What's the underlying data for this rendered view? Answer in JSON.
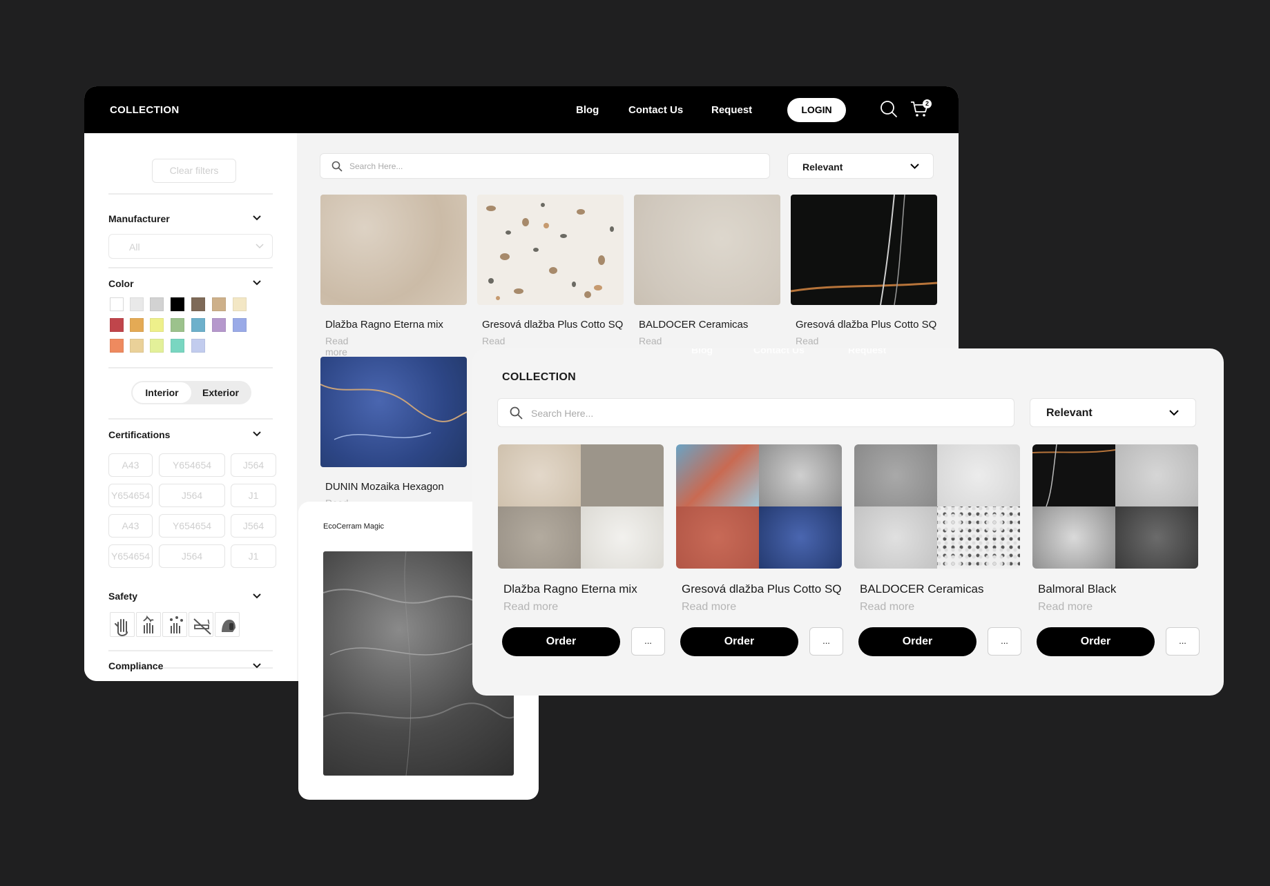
{
  "main": {
    "brand": "COLLECTION",
    "nav": [
      "Blog",
      "Contact Us",
      "Request"
    ],
    "login": "LOGIN",
    "cart_count": "2",
    "clear_filters": "Clear filters",
    "manufacturer": {
      "title": "Manufacturer",
      "value": "All"
    },
    "color": {
      "title": "Color",
      "swatches": [
        "#ffffff",
        "#e9e9e9",
        "#d2d2d2",
        "#000000",
        "#7e6a58",
        "#cdb08a",
        "#f3e7c5",
        "#c0454b",
        "#e4aa55",
        "#eef08b",
        "#9cc28c",
        "#6db0cb",
        "#b598cc",
        "#9aaae7",
        "#ee8a5f",
        "#ead199",
        "#e3f099",
        "#79d6c1",
        "#c2ccee"
      ]
    },
    "placement": {
      "interior": "Interior",
      "exterior": "Exterior"
    },
    "certifications": {
      "title": "Certifications",
      "rows": [
        [
          "A43",
          "Y654654",
          "J564"
        ],
        [
          "Y654654",
          "J564",
          "J1"
        ],
        [
          "A43",
          "Y654654",
          "J564"
        ],
        [
          "Y654654",
          "J564",
          "J1"
        ]
      ]
    },
    "safety": {
      "title": "Safety",
      "icons": [
        "glove-icon",
        "fire-hand-icon",
        "chemical-hand-icon",
        "no-smoking-icon",
        "hearing-protection-icon"
      ]
    },
    "compliance": {
      "title": "Compliance"
    },
    "search_placeholder": "Search Here...",
    "sort": "Relevant",
    "products": [
      {
        "name": "Dlažba Ragno Eterna mix",
        "more": "Read more"
      },
      {
        "name": "Gresová dlažba Plus Cotto SQ",
        "more": "Read more"
      },
      {
        "name": "BALDOCER Ceramicas",
        "more": "Read more"
      },
      {
        "name": "Gresová dlažba Plus Cotto SQ",
        "more": "Read more"
      },
      {
        "name": "DUNIN Mozaika Hexagon",
        "more": "Read more"
      }
    ]
  },
  "magic": {
    "title": "EcoCerram Magic"
  },
  "front": {
    "brand": "COLLECTION",
    "ghost_nav": [
      "Blog",
      "Contact Us",
      "Request"
    ],
    "search_placeholder": "Search Here...",
    "sort": "Relevant",
    "products": [
      {
        "name": "Dlažba Ragno Eterna mix",
        "more": "Read more",
        "order": "Order",
        "dots": "..."
      },
      {
        "name": "Gresová dlažba Plus Cotto SQ",
        "more": "Read more",
        "order": "Order",
        "dots": "..."
      },
      {
        "name": "BALDOCER Ceramicas",
        "more": "Read more",
        "order": "Order",
        "dots": "..."
      },
      {
        "name": "Balmoral Black",
        "more": "Read more",
        "order": "Order",
        "dots": "..."
      }
    ]
  }
}
